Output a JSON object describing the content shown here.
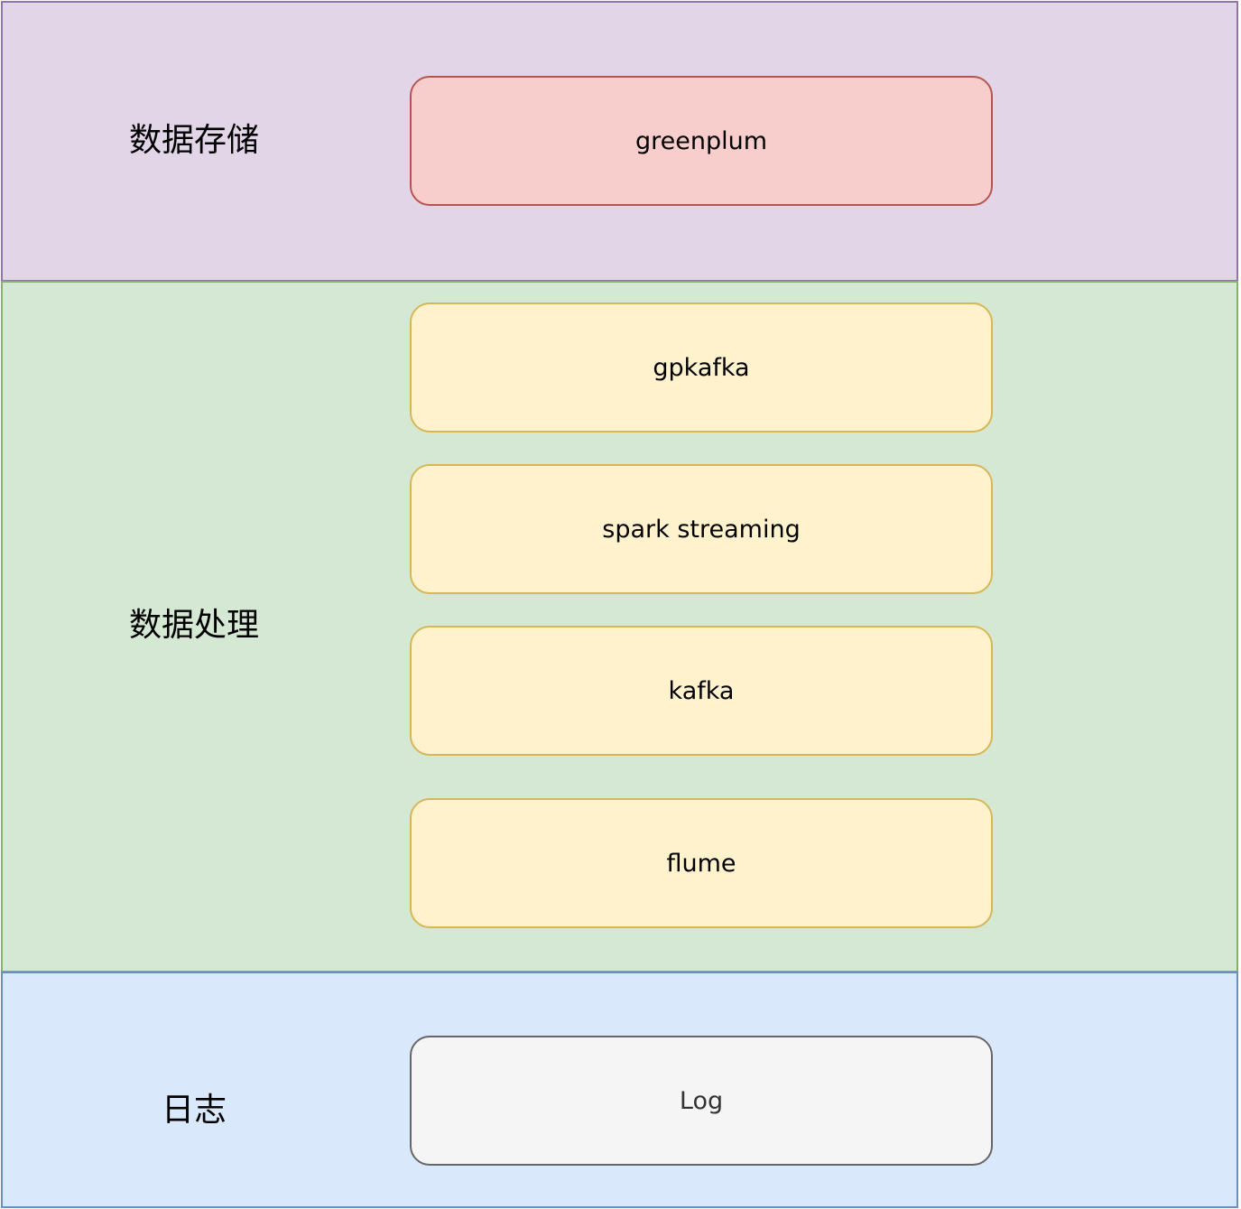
{
  "layers": {
    "storage": {
      "label": "数据存储",
      "nodes": [
        "greenplum"
      ],
      "fill": "#e1d5e7",
      "stroke": "#9673a6"
    },
    "processing": {
      "label": "数据处理",
      "nodes": [
        "gpkafka",
        "spark streaming",
        "kafka",
        "flume"
      ],
      "fill": "#d5e8d4",
      "stroke": "#82b366"
    },
    "log": {
      "label": "日志",
      "nodes": [
        "Log"
      ],
      "fill": "#dae8fc",
      "stroke": "#6c8ebf"
    }
  },
  "node_colors": {
    "storage_node_fill": "#f8cecc",
    "storage_node_stroke": "#b85450",
    "processing_node_fill": "#fff2cc",
    "processing_node_stroke": "#d6b656",
    "log_node_fill": "#f5f5f5",
    "log_node_stroke": "#666666"
  }
}
